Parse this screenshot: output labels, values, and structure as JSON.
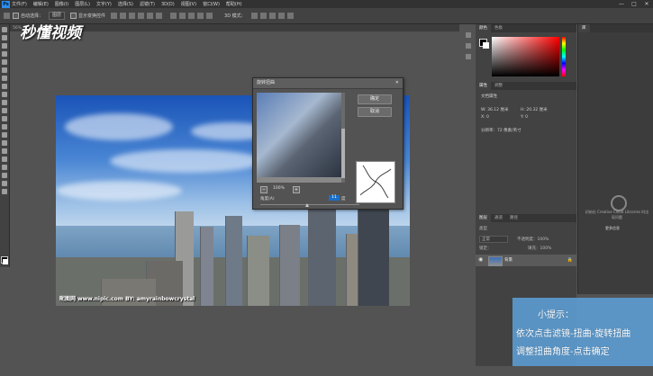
{
  "menubar": {
    "logo": "Ps",
    "items": [
      "文件(F)",
      "编辑(E)",
      "图像(I)",
      "图层(L)",
      "文字(Y)",
      "选择(S)",
      "滤镜(T)",
      "3D(D)",
      "视图(V)",
      "窗口(W)",
      "帮助(H)"
    ],
    "window_controls": [
      "—",
      "□",
      "✕"
    ]
  },
  "options": {
    "auto_select_label": "自动选择：",
    "auto_select_value": "图层",
    "transform_label": "显示变换控件",
    "mode_3d_label": "3D 模式："
  },
  "tabbar": {
    "title": "56%"
  },
  "watermark": {
    "text": "秒懂视频"
  },
  "document": {
    "credit": "昵图网 www.nipic.com   BY: amyrainbowcrystal"
  },
  "dialog": {
    "title": "旋转扭曲",
    "ok_label": "确定",
    "cancel_label": "取消",
    "zoom_minus": "−",
    "zoom_plus": "+",
    "zoom_value": "100%",
    "angle_label": "角度(A)",
    "angle_value": "11",
    "angle_unit": "度"
  },
  "right_dock": {
    "color_tabs": [
      "颜色",
      "色板"
    ],
    "props_tabs": [
      "属性",
      "调整"
    ],
    "props_title": "文档属性",
    "props_w": "W:  36.12 厘米",
    "props_h": "H:  20.32 厘米",
    "props_x": "X:  0",
    "props_y": "Y:  0",
    "props_res": "分辨率：72 像素/英寸",
    "layers_tabs": [
      "图层",
      "通道",
      "路径"
    ],
    "layers_kind": "类型",
    "layers_mode": "正常",
    "layers_opacity": "不透明度：100%",
    "layers_lock": "锁定：",
    "layers_fill": "填充：100%",
    "layer_name": "背景"
  },
  "far_right": {
    "tab": "库",
    "cc_text": "初始化 Creative Cloud Libraries 时出现问题",
    "cc_link": "更多信息"
  },
  "tip": {
    "title": "小提示：",
    "line1": "依次点击滤镜-扭曲-旋转扭曲",
    "line2": "调整扭曲角度-点击确定"
  },
  "colors": {
    "accent": "#1a6fc8",
    "tip_bg": "#5c9ed6"
  }
}
